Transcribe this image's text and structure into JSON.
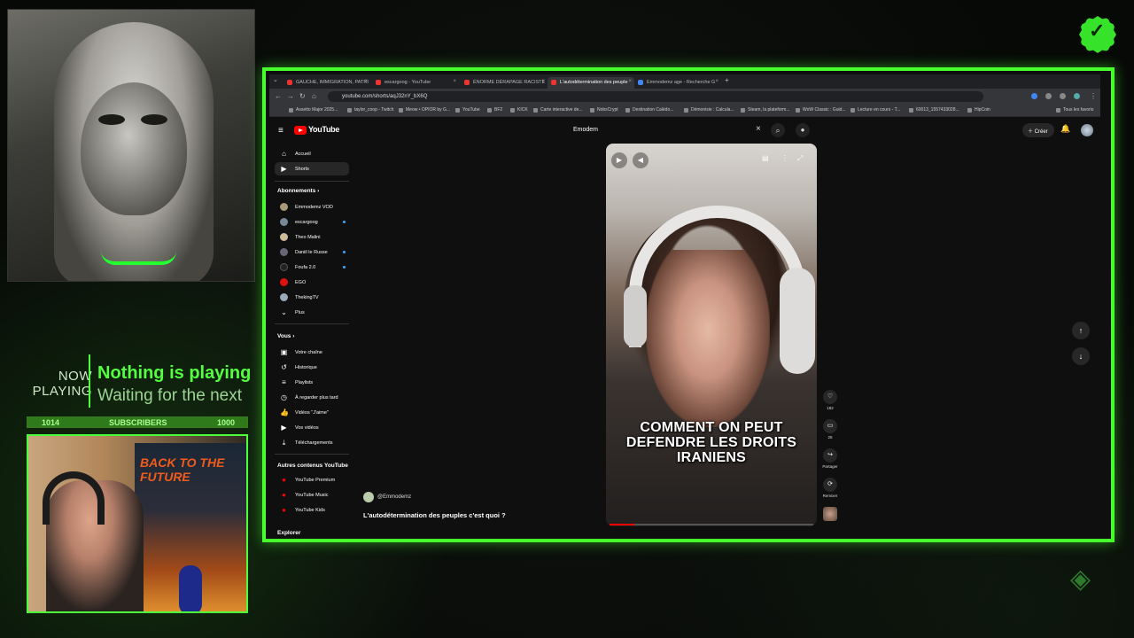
{
  "overlay": {
    "now_playing_label": "NOW PLAYING",
    "now_playing_title": "Nothing is playing",
    "now_playing_sub": "Waiting for the next",
    "subs_current": "1014",
    "subs_label": "SUBSCRIBERS",
    "subs_goal": "1000",
    "subs_progress": 1.0,
    "poster_title": "BACK TO THE FUTURE",
    "accent": "#47ff2c"
  },
  "browser": {
    "tabs": [
      {
        "label": "GAUCHE, IMMIGRATION, PATRI"
      },
      {
        "label": "escargoog - YouTube"
      },
      {
        "label": "ÉNORME DÉRAPAGE RACISTE"
      },
      {
        "label": "L'autodétermination des peuple"
      },
      {
        "label": "Emmodemz age - Recherche G"
      }
    ],
    "new_tab": "+",
    "url": "youtube.com/shorts/aqJ32nY_bX6Q",
    "bookmarks": [
      "Assetto Major 2025...",
      "taylor_coop - Twitch",
      "Meow • OPIOR by G...",
      "YouTube",
      "BF2",
      "KICK",
      "Carte interactive de...",
      "NobsCrypt",
      "Destination Calédo...",
      "Démonisie : Calcula...",
      "Steam, la plateform...",
      "WoW Classic : Guid...",
      "Lecture en cours - T...",
      "60013_1557433028...",
      "HipCoin",
      "Tous les favoris"
    ]
  },
  "youtube": {
    "logo": "YouTube",
    "search_value": "Emodem",
    "create_label": "Créer",
    "sidebar_main": [
      {
        "label": "Accueil",
        "icon": "home-icon"
      },
      {
        "label": "Shorts",
        "icon": "shorts-icon"
      }
    ],
    "subscriptions_header": "Abonnements",
    "subscriptions": [
      {
        "label": "Emmodemz VOD",
        "dot": false
      },
      {
        "label": "escargoog",
        "dot": true
      },
      {
        "label": "Theo Malini",
        "dot": false
      },
      {
        "label": "Daniil le Russe",
        "dot": true
      },
      {
        "label": "Foufa 2.0",
        "dot": true
      },
      {
        "label": "EGO",
        "dot": false
      },
      {
        "label": "ThekingTV",
        "dot": false
      },
      {
        "label": "Plus",
        "dot": false
      }
    ],
    "you_header": "Vous",
    "you_items": [
      {
        "label": "Votre chaîne"
      },
      {
        "label": "Historique"
      },
      {
        "label": "Playlists"
      },
      {
        "label": "À regarder plus tard"
      },
      {
        "label": "Vidéos \"J'aime\""
      },
      {
        "label": "Vos vidéos"
      },
      {
        "label": "Téléchargements"
      }
    ],
    "more_header": "Autres contenus YouTube",
    "more_items": [
      {
        "label": "YouTube Premium"
      },
      {
        "label": "YouTube Music"
      },
      {
        "label": "YouTube Kids"
      }
    ],
    "explore_header": "Explorer",
    "short": {
      "caption": "COMMENT ON PEUT DEFENDRE LES DROITS IRANIENS",
      "channel": "@Emmodemz",
      "title": "L'autodétermination des peuples c'est quoi ?",
      "likes": "182",
      "comments": "25",
      "share_label": "Partager",
      "remix_label": "Remixer",
      "progress": 0.12
    }
  }
}
